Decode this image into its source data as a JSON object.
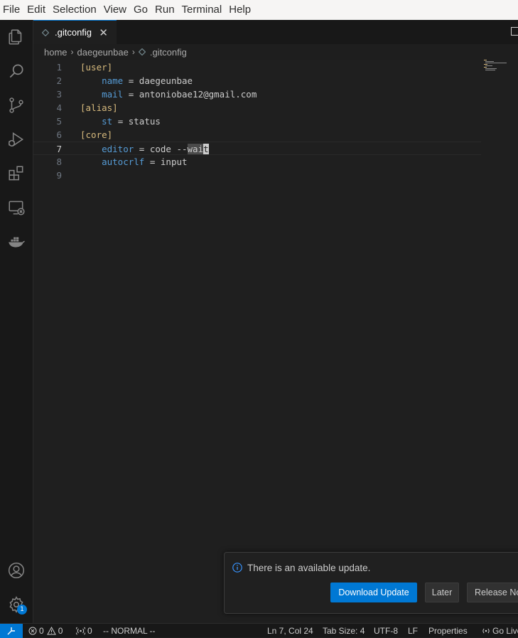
{
  "menu": [
    "File",
    "Edit",
    "Selection",
    "View",
    "Go",
    "Run",
    "Terminal",
    "Help"
  ],
  "activity": {
    "items": [
      "explorer-icon",
      "search-icon",
      "source-control-icon",
      "run-debug-icon",
      "extensions-icon",
      "remote-explorer-icon",
      "docker-icon"
    ],
    "accounts": "account-icon",
    "manage": "gear-icon",
    "manage_badge": "1"
  },
  "tab": {
    "label": ".gitconfig",
    "close": "✕"
  },
  "breadcrumb": [
    "home",
    "daegeunbae",
    ".gitconfig"
  ],
  "editor": {
    "lines": [
      {
        "n": "1",
        "tokens": [
          [
            "sec",
            "[user]"
          ]
        ]
      },
      {
        "n": "2",
        "tokens": [
          [
            "ws",
            "    "
          ],
          [
            "key",
            "name"
          ],
          [
            "val",
            " = daegeunbae"
          ]
        ]
      },
      {
        "n": "3",
        "tokens": [
          [
            "ws",
            "    "
          ],
          [
            "key",
            "mail"
          ],
          [
            "val",
            " = antoniobae12@gmail.com"
          ]
        ]
      },
      {
        "n": "4",
        "tokens": [
          [
            "sec",
            "[alias]"
          ]
        ]
      },
      {
        "n": "5",
        "tokens": [
          [
            "ws",
            "    "
          ],
          [
            "key",
            "st"
          ],
          [
            "val",
            " = status"
          ]
        ]
      },
      {
        "n": "6",
        "tokens": [
          [
            "sec",
            "[core]"
          ]
        ]
      },
      {
        "n": "7",
        "tokens": [
          [
            "ws",
            "    "
          ],
          [
            "key",
            "editor"
          ],
          [
            "val",
            " = code --"
          ],
          [
            "sel",
            "wai"
          ],
          [
            "cursor",
            "t"
          ]
        ]
      },
      {
        "n": "8",
        "tokens": [
          [
            "ws",
            "    "
          ],
          [
            "key",
            "autocrlf"
          ],
          [
            "val",
            " = input"
          ]
        ]
      },
      {
        "n": "9",
        "tokens": []
      }
    ],
    "active_line": "7"
  },
  "notification": {
    "message": "There is an available update.",
    "primary": "Download Update",
    "later": "Later",
    "release": "Release Notes"
  },
  "status": {
    "errors": "0",
    "warnings": "0",
    "ports": "0",
    "mode": "-- NORMAL --",
    "position": "Ln 7, Col 24",
    "tabsize": "Tab Size: 4",
    "encoding": "UTF-8",
    "eol": "LF",
    "language": "Properties",
    "golive": "Go Live"
  },
  "colors": {
    "accent": "#0078d4",
    "section": "#d7ba7d",
    "key": "#569cd6"
  }
}
